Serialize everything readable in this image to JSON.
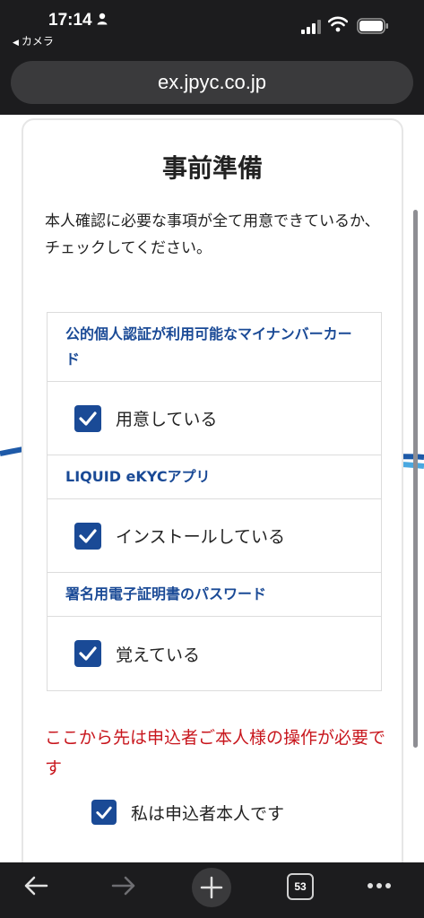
{
  "status_bar": {
    "time": "17:14",
    "back_app": "カメラ"
  },
  "browser": {
    "url": "ex.jpyc.co.jp",
    "tab_count": "53"
  },
  "page": {
    "title": "事前準備",
    "intro": "本人確認に必要な事項が全て用意できているか、チェックしてください。",
    "sections": [
      {
        "heading": "公的個人認証が利用可能なマイナンバーカード",
        "check_label": "用意している",
        "checked": true
      },
      {
        "heading": "LIQUID eKYCアプリ",
        "check_label": "インストールしている",
        "checked": true
      },
      {
        "heading": "署名用電子証明書のパスワード",
        "check_label": "覚えている",
        "checked": true
      }
    ],
    "warning": "ここから先は申込者ご本人様の操作が必要です",
    "final_check_label": "私は申込者本人です",
    "final_checked": true
  },
  "colors": {
    "accent": "#1a4a96",
    "warning": "#c8161d"
  },
  "icons": [
    "person-icon",
    "signal-icon",
    "wifi-icon",
    "battery-icon",
    "back-arrow-icon",
    "forward-arrow-icon",
    "new-tab-plus-icon",
    "more-icon",
    "checkmark-icon"
  ]
}
